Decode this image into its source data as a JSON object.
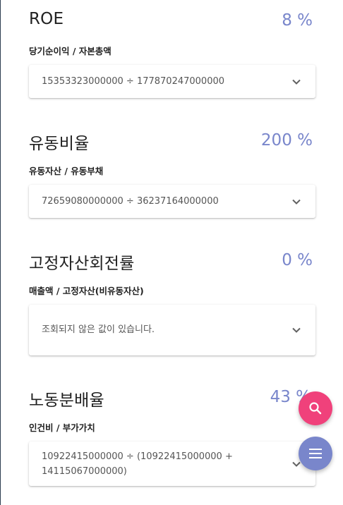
{
  "metrics": [
    {
      "title": "ROE",
      "value": "8 %",
      "formula": "당기순이익 / 자본총액",
      "detail": "15353323000000 ÷ 177870247000000"
    },
    {
      "title": "유동비율",
      "value": "200 %",
      "formula": "유동자산 / 유동부채",
      "detail": "72659080000000 ÷ 36237164000000"
    },
    {
      "title": "고정자산회전률",
      "value": "0 %",
      "formula": "매출액 / 고정자산(비유동자산)",
      "detail": "조회되지 않은 값이 있습니다."
    },
    {
      "title": "노동분배율",
      "value": "43 %",
      "formula": "인건비 / 부가가치",
      "detail": "10922415000000 ÷ (10922415000000 + 14115067000000)"
    }
  ],
  "fabs": {
    "search_icon": "search-icon",
    "menu_icon": "menu-icon"
  },
  "colors": {
    "accent": "#7986cb",
    "fab_pink": "#f0417b",
    "chevron": "#616161"
  }
}
